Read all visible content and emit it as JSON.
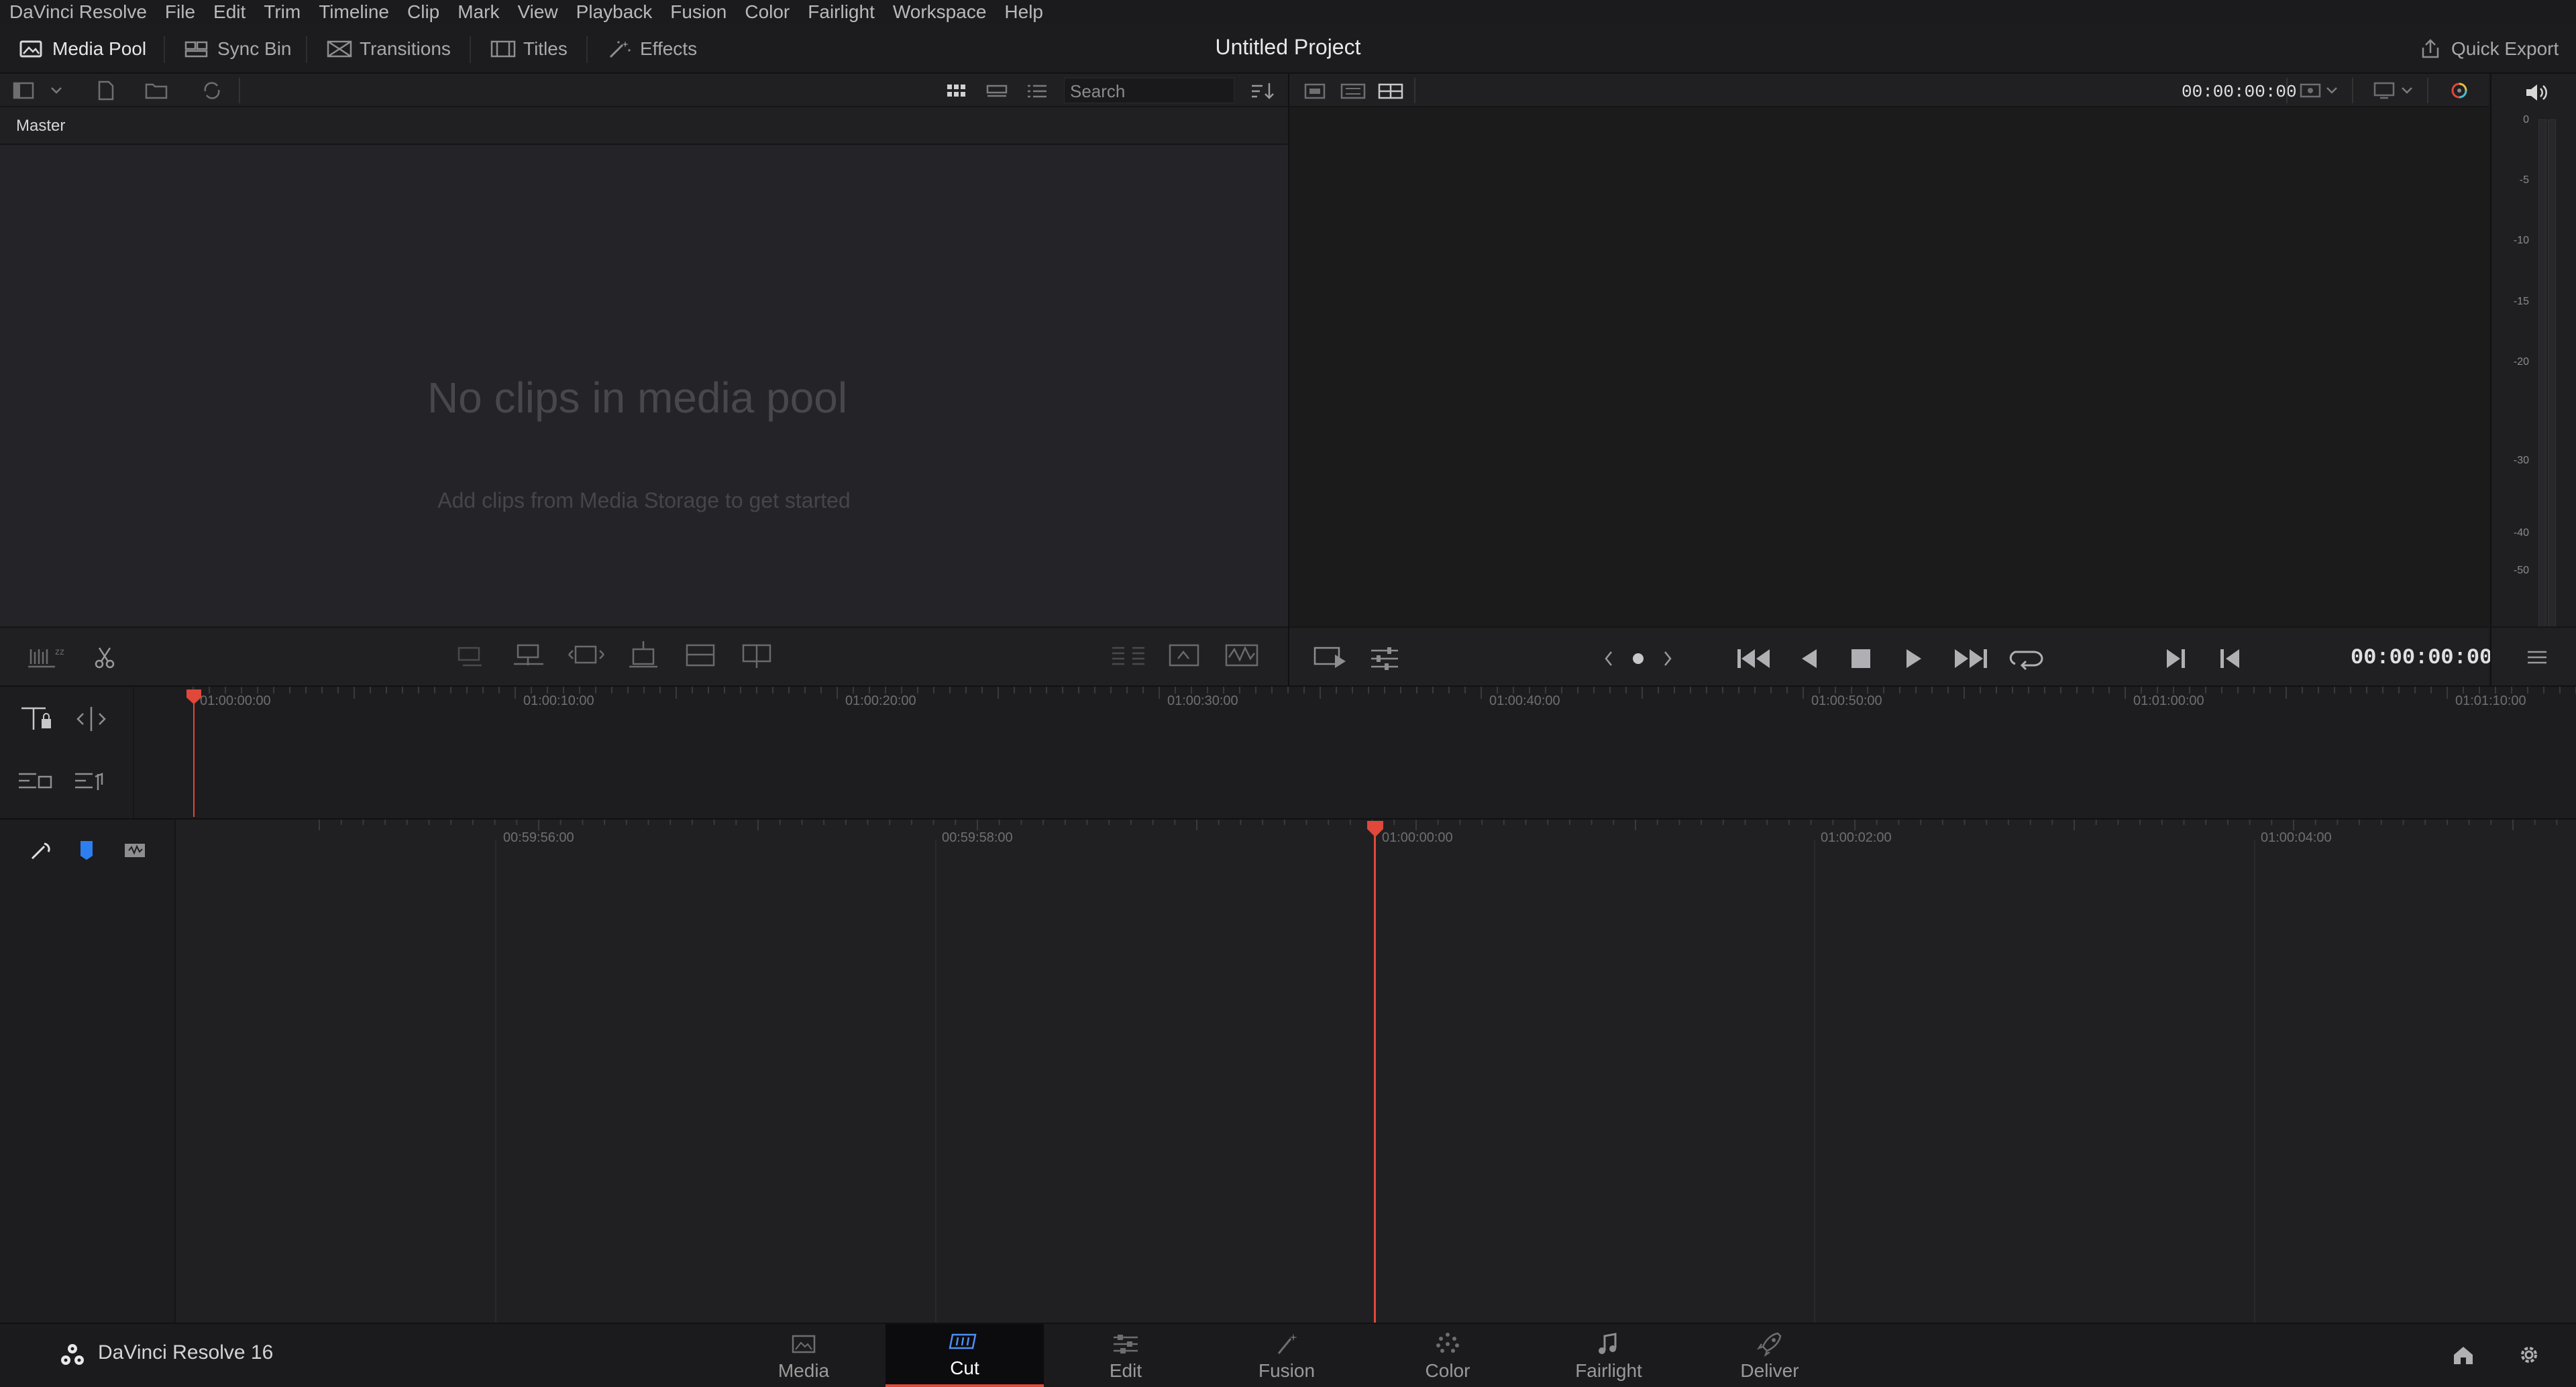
{
  "menubar": {
    "items": [
      "DaVinci Resolve",
      "File",
      "Edit",
      "Trim",
      "Timeline",
      "Clip",
      "Mark",
      "View",
      "Playback",
      "Fusion",
      "Color",
      "Fairlight",
      "Workspace",
      "Help"
    ]
  },
  "toolbar": {
    "media_pool": "Media Pool",
    "sync_bin": "Sync Bin",
    "transitions": "Transitions",
    "titles": "Titles",
    "effects": "Effects",
    "project_title": "Untitled Project",
    "quick_export": "Quick Export"
  },
  "media_pool": {
    "bin_label": "Master",
    "search_placeholder": "Search",
    "empty_title": "No clips in media pool",
    "empty_subtitle": "Add clips from Media Storage to get started"
  },
  "viewer": {
    "header_timecode": "00:00:00:00",
    "timecode": "00:00:00:00"
  },
  "audio_meter": {
    "labels": [
      "0",
      "-5",
      "-10",
      "-15",
      "-20",
      "-30",
      "-40",
      "-50"
    ]
  },
  "upper_timeline": {
    "ticks": [
      "01:00:00:00",
      "01:00:10:00",
      "01:00:20:00",
      "01:00:30:00",
      "01:00:40:00",
      "01:00:50:00",
      "01:01:00:00",
      "01:01:10:00"
    ]
  },
  "lower_timeline": {
    "ticks": [
      "00:59:56:00",
      "00:59:58:00",
      "01:00:00:00",
      "01:00:02:00",
      "01:00:04:00"
    ]
  },
  "bottombar": {
    "brand": "DaVinci Resolve 16",
    "pages": [
      "Media",
      "Cut",
      "Edit",
      "Fusion",
      "Color",
      "Fairlight",
      "Deliver"
    ],
    "active_page": "Cut"
  },
  "colors": {
    "playhead": "#e0483a",
    "background": "#1b1b1d",
    "active_tab": "#0c0c0e"
  }
}
